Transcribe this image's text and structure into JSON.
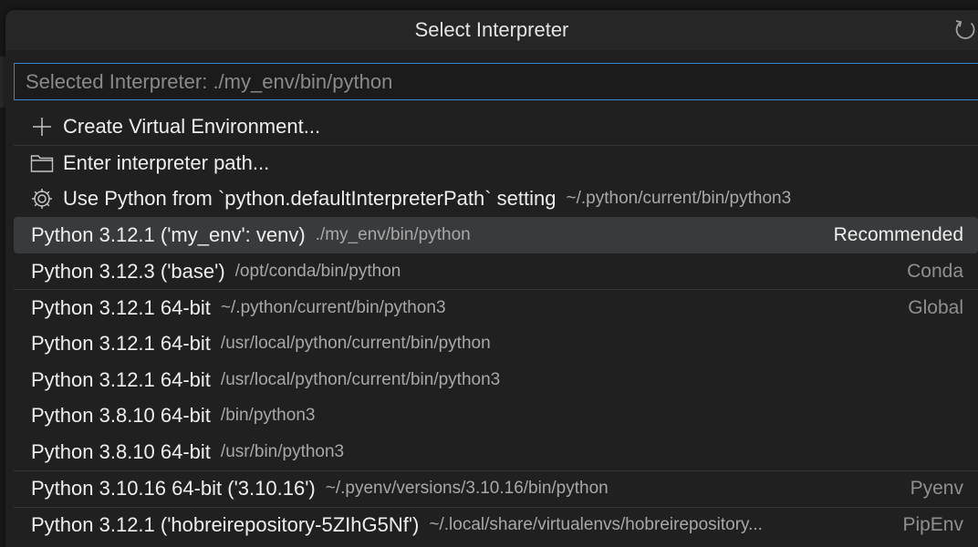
{
  "title": "Select Interpreter",
  "search": {
    "placeholder": "Selected Interpreter: ./my_env/bin/python"
  },
  "actions": [
    {
      "icon": "plus-icon",
      "label": "Create Virtual Environment..."
    },
    {
      "icon": "folder-icon",
      "label": "Enter interpreter path..."
    },
    {
      "icon": "gear-icon",
      "label": "Use Python from `python.defaultInterpreterPath` setting",
      "desc": "~/.python/current/bin/python3"
    }
  ],
  "interpreters": [
    {
      "label": "Python 3.12.1 ('my_env': venv)",
      "path": "./my_env/bin/python",
      "detail": "Recommended",
      "selected": true
    },
    {
      "label": "Python 3.12.3 ('base')",
      "path": "/opt/conda/bin/python",
      "detail": "Conda"
    },
    {
      "label": "Python 3.12.1 64-bit",
      "path": "~/.python/current/bin/python3",
      "detail": "Global"
    },
    {
      "label": "Python 3.12.1 64-bit",
      "path": "/usr/local/python/current/bin/python"
    },
    {
      "label": "Python 3.12.1 64-bit",
      "path": "/usr/local/python/current/bin/python3"
    },
    {
      "label": "Python 3.8.10 64-bit",
      "path": "/bin/python3"
    },
    {
      "label": "Python 3.8.10 64-bit",
      "path": "/usr/bin/python3"
    },
    {
      "label": "Python 3.10.16 64-bit ('3.10.16')",
      "path": "~/.pyenv/versions/3.10.16/bin/python",
      "detail": "Pyenv"
    },
    {
      "label": "Python 3.12.1 ('hobreirepository-5ZIhG5Nf')",
      "path": "~/.local/share/virtualenvs/hobreirepository...",
      "detail": "PipEnv"
    }
  ],
  "colors": {
    "accent_border": "#3a86d6",
    "selected_row": "#383a3c",
    "background": "#202020"
  }
}
